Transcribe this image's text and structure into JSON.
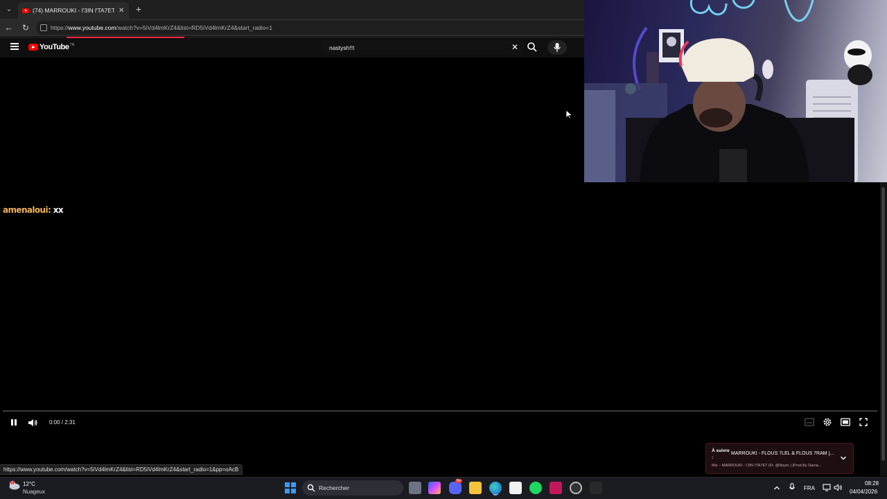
{
  "browser": {
    "tab_title": "(74) MARROUKI - l'3IN l'TA7ET (Ft",
    "url_prefix": "https://",
    "url_host": "www.youtube.com",
    "url_path": "/watch?v=5iVd4lmKrZ4&list=RD5iVd4lmKrZ4&start_radio=1"
  },
  "youtube": {
    "logo_text": "YouTube",
    "logo_tn": "TN",
    "search_value": "nastysh!!t"
  },
  "chat": {
    "user": "amenaloui:",
    "message": "xx"
  },
  "player": {
    "time": "0:00 / 2:31",
    "progress_fraction": 0.0
  },
  "up_next": {
    "label": "À suivre :",
    "title": "MARROUKI - FLOUS 7LEL & FLOUS 7RAM [...",
    "subtitle": "Mix – MARROUKI - l'3IN l'TA7ET (Ft. @Nayto ) [Prod.By Dama..."
  },
  "status_url": "https://www.youtube.com/watch?v=5iVd4lmKrZ4&list=RD5iVd4lmKrZ4&start_radio=1&pp=oAcB",
  "taskbar": {
    "weather_temp": "12°C",
    "weather_desc": "Nuageux",
    "weather_badge": "1",
    "search_placeholder": "Rechercher",
    "discord_badge": "9+",
    "language": "FRA",
    "time": "08:28",
    "date": "04/04/2026"
  },
  "colors": {
    "youtube_red": "#ff0000",
    "chat_user": "#f0b45a",
    "loading_bar": "#ff2a3d"
  }
}
